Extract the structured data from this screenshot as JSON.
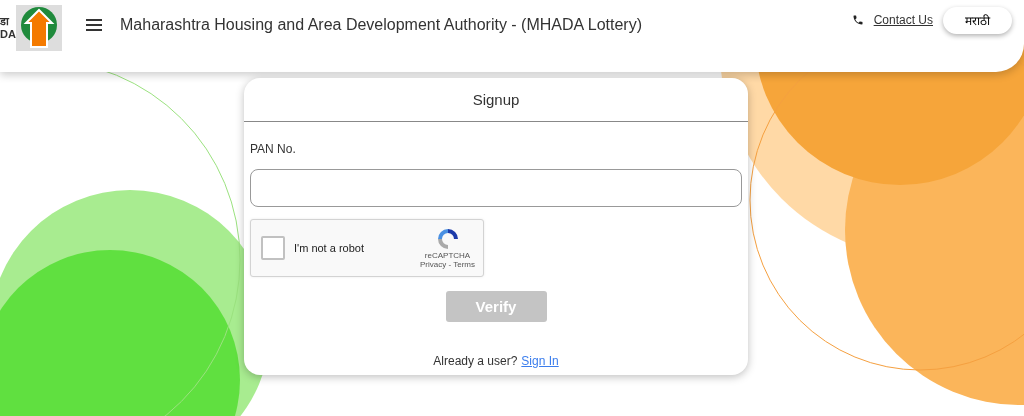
{
  "header": {
    "logo_text": [
      "डा",
      "DA"
    ],
    "title": "Maharashtra Housing and Area Development Authority - (MHADA Lottery)",
    "contact_link": "Contact Us",
    "language_button": "मराठी"
  },
  "signup": {
    "title": "Signup",
    "field_label": "PAN No.",
    "captcha": {
      "label": "I'm not a robot",
      "checked": false,
      "brand": "reCAPTCHA",
      "links": "Privacy - Terms"
    },
    "verify_button": {
      "label": "Verify",
      "disabled": true
    },
    "footer_text": "Already a user?",
    "footer_link": "Sign In"
  }
}
